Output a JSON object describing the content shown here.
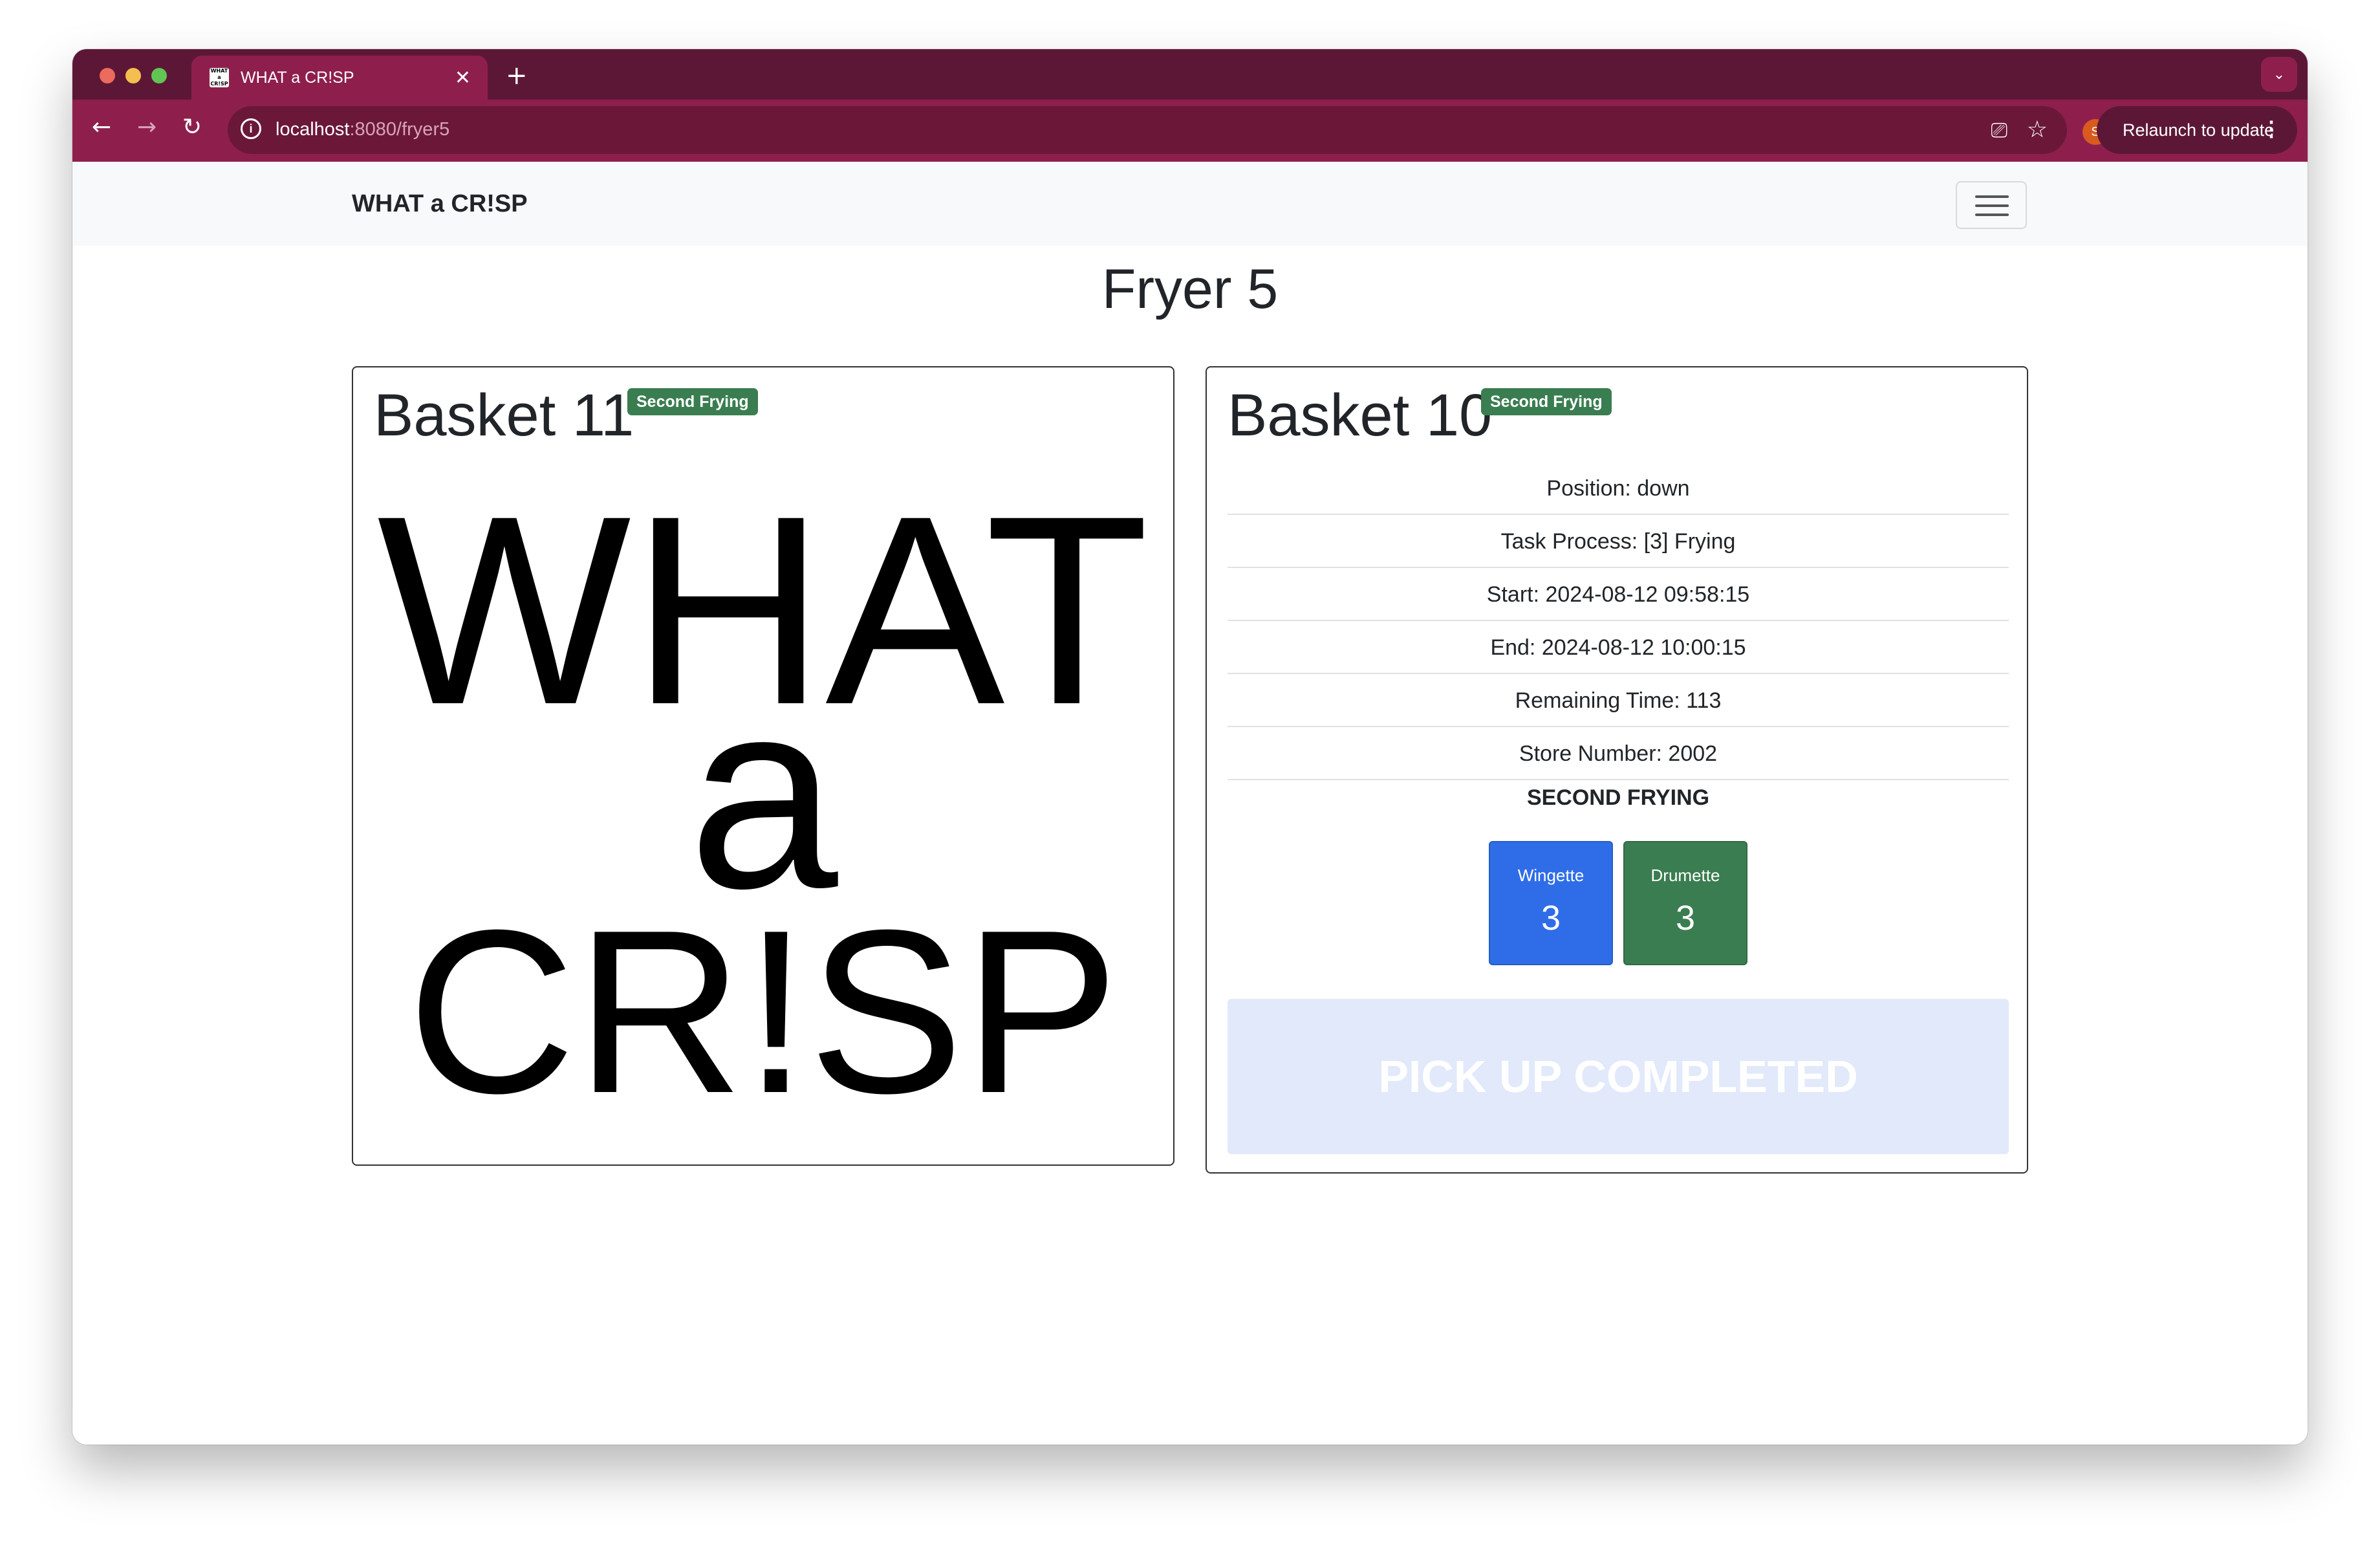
{
  "browser": {
    "tab_title": "WHAT a CR!SP",
    "favicon_text": "WHAT a CR!SP",
    "close_glyph": "✕",
    "new_tab_glyph": "+",
    "url_host": "localhost",
    "url_path": ":8080/fryer5",
    "profile_initial": "S",
    "relaunch_label": "Relaunch to update",
    "icons": [
      "back-arrow-icon",
      "forward-arrow-icon",
      "reload-icon",
      "site-info-icon",
      "install-app-icon",
      "bookmark-star-icon",
      "more-menu-icon",
      "tab-search-icon"
    ]
  },
  "navbar": {
    "brand": "WHAT a CR!SP"
  },
  "page": {
    "title": "Fryer 5"
  },
  "baskets": [
    {
      "title": "Basket 11",
      "badge": "Second Frying",
      "logo": [
        "WHAT",
        "a",
        "CR!SP"
      ]
    },
    {
      "title": "Basket 10",
      "badge": "Second Frying",
      "details": [
        "Position: down",
        "Task Process: [3] Frying",
        "Start: 2024-08-12 09:58:15",
        "End: 2024-08-12 10:00:15",
        "Remaining Time: 113",
        "Store Number: 2002"
      ],
      "stage_heading": "SECOND FRYING",
      "pieces": [
        {
          "label": "Wingette",
          "count": "3",
          "color": "#2f6de8"
        },
        {
          "label": "Drumette",
          "count": "3",
          "color": "#3a7d50"
        }
      ],
      "action_label": "PICK UP COMPLETED"
    }
  ],
  "colors": {
    "tabstrip": "#5d1736",
    "toolbar": "#8e1f4d",
    "badge": "#3a7d50",
    "pickup_disabled": "#e1e9fb"
  }
}
